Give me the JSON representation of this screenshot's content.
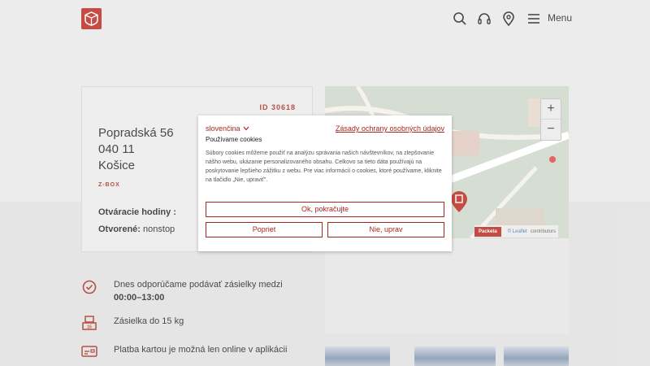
{
  "header": {
    "menu_label": "Menu",
    "icons": [
      "search-icon",
      "headset-icon",
      "location-pin-icon",
      "hamburger-icon"
    ]
  },
  "branch": {
    "id": "ID 30618",
    "street": "Popradská 56",
    "zip": "040 11",
    "city": "Košice",
    "type": "Z-BOX",
    "hours_label": "Otváracie hodiny :",
    "open_label": "Otvorené:",
    "open_value": "nonstop"
  },
  "map": {
    "zoom_in": "+",
    "zoom_out": "−",
    "attribution_brand": "Packeta",
    "attribution_link": "© Leaflet",
    "attribution_suffix": "contributors"
  },
  "features": [
    {
      "icon": "clock-icon",
      "text_prefix": "Dnes odporúčame podávať zásielky medzi ",
      "text_bold": "00:00–13:00"
    },
    {
      "icon": "weight-icon",
      "text": "Zásielka do 15 kg"
    },
    {
      "icon": "card-icon",
      "text": "Platba kartou je možná len online v aplikácii"
    }
  ],
  "cookie": {
    "language": "slovenčina",
    "policy_link": "Zásady ochrany osobných údajov",
    "title": "Používame cookies",
    "body": "Súbory cookies môžeme použiť na analýzu správania našich návštevníkov, na zlepšovanie nášho webu, ukázanie personalizovaného obsahu. Celkovo sa tieto dáta používajú na poskytovanie lepšieho zážitku z webu. Pre viac informácií o cookies, ktoré používame, kliknite na tlačidlo „Nie, upraviť\".",
    "accept_label": "Ok, pokračujte",
    "deny_label": "Popriet",
    "adjust_label": "Nie, uprav"
  },
  "colors": {
    "brand": "#b8251c",
    "accent_text": "#a6281f"
  }
}
